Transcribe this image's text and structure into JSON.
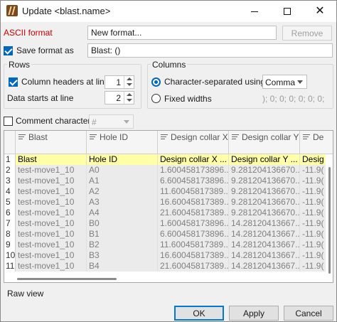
{
  "window": {
    "title": "Update <blast.name>"
  },
  "ascii_format": {
    "label": "ASCII format",
    "value": "New format...",
    "remove_label": "Remove"
  },
  "save_format": {
    "label": "Save format as",
    "checked": true,
    "value": "Blast: ()"
  },
  "rows_group": {
    "title": "Rows",
    "column_headers_label": "Column headers at line",
    "column_headers_value": "1",
    "data_starts_label": "Data starts at line",
    "data_starts_value": "2"
  },
  "columns_group": {
    "title": "Columns",
    "char_sep_label": "Character-separated using",
    "separator": "Comma",
    "fixed_widths_label": "Fixed widths",
    "fixed_widths_value": "); 0; 0; 0; 0; 0; 0;"
  },
  "comment": {
    "label": "Comment character",
    "checked": false,
    "value": "#"
  },
  "table": {
    "headers": [
      "Blast",
      "Hole ID",
      "Design collar X",
      "Design collar Y",
      "De"
    ],
    "header_row": {
      "num": "1",
      "cells": [
        "Blast",
        "Hole ID",
        "Design collar X ...",
        "Design collar Y ...",
        "Desig"
      ]
    },
    "rows": [
      {
        "num": "2",
        "cells": [
          "test-move1_10",
          "A0",
          "1.600458173896...",
          "9.281204136670...",
          "-11.9("
        ]
      },
      {
        "num": "3",
        "cells": [
          "test-move1_10",
          "A1",
          "6.600458173896...",
          "9.281204136670...",
          "-11.9("
        ]
      },
      {
        "num": "4",
        "cells": [
          "test-move1_10",
          "A2",
          "11.60045817389...",
          "9.281204136670...",
          "-11.9("
        ]
      },
      {
        "num": "5",
        "cells": [
          "test-move1_10",
          "A3",
          "16.60045817389...",
          "9.281204136670...",
          "-11.9("
        ]
      },
      {
        "num": "6",
        "cells": [
          "test-move1_10",
          "A4",
          "21.60045817389...",
          "9.281204136670...",
          "-11.9("
        ]
      },
      {
        "num": "7",
        "cells": [
          "test-move1_10",
          "B0",
          "1.600458173896...",
          "14.28120413667...",
          "-11.9("
        ]
      },
      {
        "num": "8",
        "cells": [
          "test-move1_10",
          "B1",
          "6.600458173896...",
          "14.28120413667...",
          "-11.9("
        ]
      },
      {
        "num": "9",
        "cells": [
          "test-move1_10",
          "B2",
          "11.60045817389...",
          "14.28120413667...",
          "-11.9("
        ]
      },
      {
        "num": "10",
        "cells": [
          "test-move1_10",
          "B3",
          "16.60045817389...",
          "14.28120413667...",
          "-11.9("
        ]
      },
      {
        "num": "11",
        "cells": [
          "test-move1_10",
          "B4",
          "21.60045817389...",
          "14.28120413667...",
          "-11.9("
        ]
      }
    ]
  },
  "raw_view": {
    "label": "Raw view"
  },
  "buttons": {
    "ok": "OK",
    "apply": "Apply",
    "cancel": "Cancel"
  },
  "colors": {
    "accent": "#0067c0",
    "header_row_bg": "#ffffa8",
    "error_label": "#cc0000"
  },
  "icons": {
    "app": "blast-app-icon",
    "minimize": "minimize-icon",
    "maximize": "maximize-icon",
    "close": "close-icon",
    "sort": "sort-lines-icon"
  }
}
